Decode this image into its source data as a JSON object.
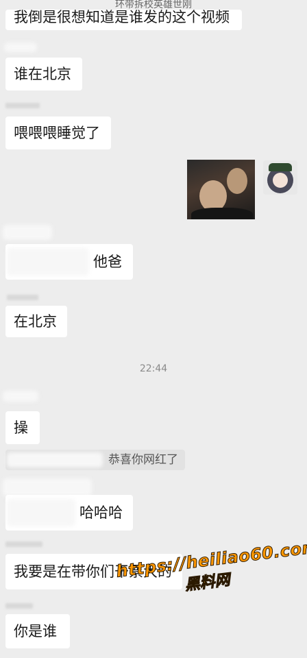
{
  "header": {
    "title": "环带拆校英雄世刚"
  },
  "messages": [
    {
      "text": "我倒是很想知道是谁发的这个视频"
    },
    {
      "text": "谁在北京"
    },
    {
      "text": "喂喂喂睡觉了"
    },
    {
      "text": "他爸"
    },
    {
      "text": "在北京"
    },
    {
      "text": "操"
    },
    {
      "text": "哈哈哈"
    },
    {
      "text": "我要是在带你们干票大的"
    },
    {
      "text": "你是谁"
    }
  ],
  "timestamp": "22:44",
  "system": {
    "text": "恭喜你网红了"
  },
  "watermark": {
    "url": "https://heiliao60.com",
    "name": "黑料网"
  },
  "colors": {
    "bubble": "#ffffff",
    "background": "#ededed",
    "watermark": "#ff9800"
  }
}
